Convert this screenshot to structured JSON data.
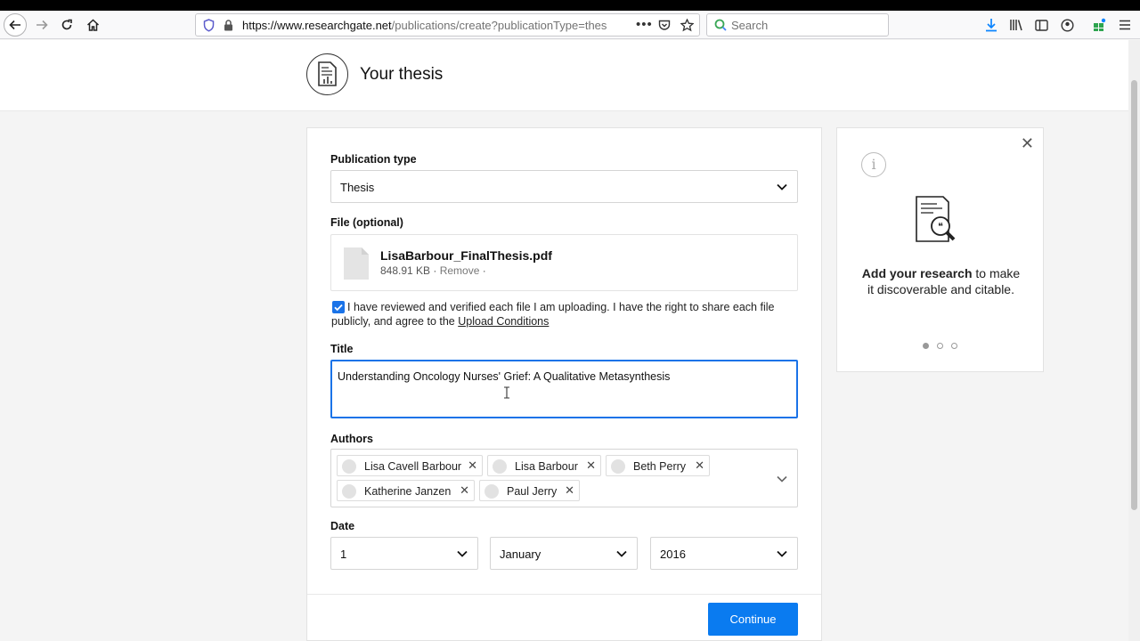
{
  "browser": {
    "url_host": "https://www.researchgate.net",
    "url_path": "/publications/create?publicationType=thes",
    "search_placeholder": "Search"
  },
  "header": {
    "title": "Your thesis"
  },
  "form": {
    "publication_type_label": "Publication type",
    "publication_type_value": "Thesis",
    "file_label": "File (optional)",
    "file_name": "LisaBarbour_FinalThesis.pdf",
    "file_size": "848.91 KB",
    "file_sep": " · ",
    "file_remove": "Remove",
    "file_sep_end": " ·",
    "agree_text": "I have reviewed and verified each file I am uploading. I have the right to share each file publicly, and agree to the ",
    "agree_link": "Upload Conditions",
    "title_label": "Title",
    "title_value": "Understanding Oncology Nurses' Grief: A Qualitative Metasynthesis",
    "authors_label": "Authors",
    "authors": [
      "Lisa Cavell Barbour",
      "Lisa Barbour",
      "Beth Perry",
      "Katherine Janzen",
      "Paul Jerry"
    ],
    "date_label": "Date",
    "date_day": "1",
    "date_month": "January",
    "date_year": "2016",
    "continue_label": "Continue"
  },
  "side": {
    "promo_bold": "Add your research",
    "promo_rest": " to make it discoverable and citable.",
    "dots": 3,
    "active_dot": 1
  },
  "colors": {
    "accent": "#0a7bf0",
    "focus": "#1a73e8"
  }
}
